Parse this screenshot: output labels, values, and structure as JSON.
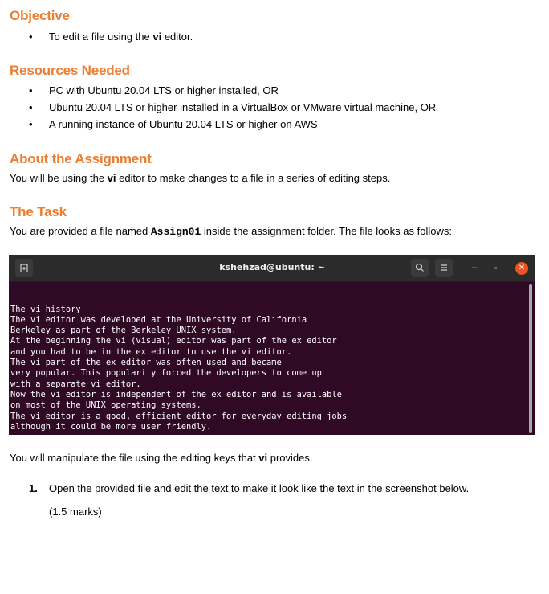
{
  "objective": {
    "heading": "Objective",
    "bullets": [
      {
        "pre": "To edit a file using the ",
        "bold": "vi",
        "post": " editor."
      }
    ]
  },
  "resources": {
    "heading": "Resources Needed",
    "bullets": [
      "PC with Ubuntu 20.04 LTS or higher installed, OR",
      "Ubuntu 20.04 LTS or higher installed in a VirtualBox or VMware virtual machine, OR",
      "A running instance of Ubuntu 20.04 LTS or higher on AWS"
    ]
  },
  "about": {
    "heading": "About the Assignment",
    "text_pre": "You will be using the ",
    "text_bold": "vi",
    "text_post": " editor to make changes to a file in a series of editing steps."
  },
  "task": {
    "heading": "The Task",
    "text_pre": "You are provided a file named ",
    "filename": "Assign01",
    "text_post": " inside the assignment folder. The file looks as follows:"
  },
  "terminal": {
    "title": "kshehzad@ubuntu: ~",
    "new_tab_icon": "new-tab-icon",
    "search_icon": "search-icon",
    "menu_icon": "hamburger-menu-icon",
    "minimize_glyph": "–",
    "restore_glyph": "▫",
    "close_glyph": "✕",
    "colors": {
      "background": "#300A24",
      "titlebar": "#2B2B2B",
      "close": "#E95420"
    },
    "lines": [
      "The vi history",
      "The vi editor was developed at the University of California",
      "Berkeley as part of the Berkeley UNIX system.",
      "At the beginning the vi (visual) editor was part of the ex editor",
      "and you had to be in the ex editor to use the vi editor.",
      "The vi part of the ex editor was often used and became",
      "very popular. This popularity forced the developers to come up",
      "with a separate vi editor.",
      "Now the vi editor is independent of the ex editor and is available",
      "on most of the UNIX operating systems.",
      "The vi editor is a good, efficient editor for everyday editing jobs",
      "although it could be more user friendly."
    ],
    "tilde": "~"
  },
  "manipulate": {
    "text_pre": "You will manipulate the file using the editing keys that ",
    "text_bold": "vi",
    "text_post": " provides."
  },
  "steps": [
    {
      "number": "1.",
      "text": "Open the provided file and edit the text to make it look like the text in the screenshot below.",
      "marks": "(1.5 marks)"
    }
  ],
  "colors": {
    "heading": "#ED7D31"
  }
}
